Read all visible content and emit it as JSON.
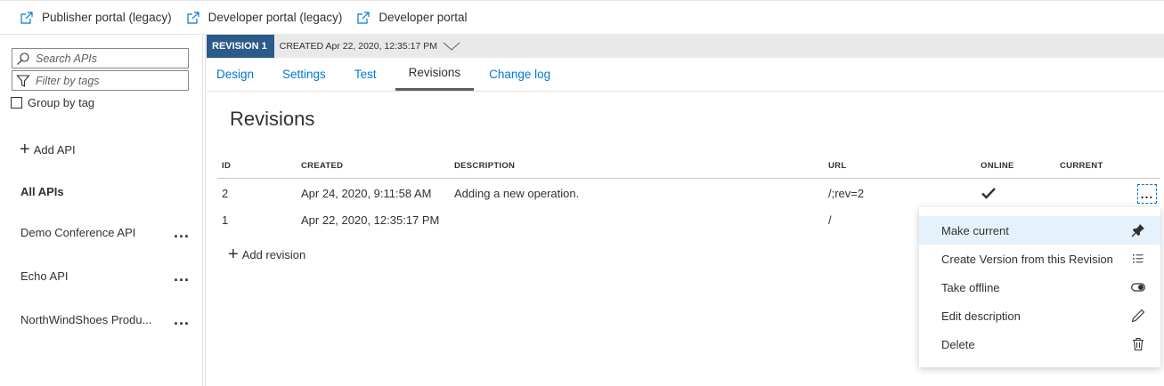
{
  "top_links": [
    {
      "label": "Publisher portal (legacy)",
      "icon": "external-link-icon"
    },
    {
      "label": "Developer portal (legacy)",
      "icon": "external-link-icon"
    },
    {
      "label": "Developer portal",
      "icon": "external-link-icon"
    }
  ],
  "sidebar": {
    "search_placeholder": "Search APIs",
    "filter_placeholder": "Filter by tags",
    "group_by_tag_label": "Group by tag",
    "add_api_label": "Add API",
    "all_apis_label": "All APIs",
    "apis": [
      {
        "name": "Demo Conference API",
        "more": "..."
      },
      {
        "name": "Echo API",
        "more": "..."
      },
      {
        "name": "NorthWindShoes Produ...",
        "more": "..."
      }
    ]
  },
  "revision_bar": {
    "tag": "REVISION 1",
    "created": "CREATED Apr 22, 2020, 12:35:17 PM"
  },
  "tabs": [
    "Design",
    "Settings",
    "Test",
    "Revisions",
    "Change log"
  ],
  "active_tab": "Revisions",
  "main": {
    "title": "Revisions",
    "columns": [
      "ID",
      "CREATED",
      "DESCRIPTION",
      "URL",
      "ONLINE",
      "CURRENT"
    ],
    "rows": [
      {
        "id": "2",
        "created": "Apr 24, 2020, 9:11:58 AM",
        "description": "Adding a new operation.",
        "url": "/;rev=2",
        "online": true,
        "more": "..."
      },
      {
        "id": "1",
        "created": "Apr 22, 2020, 12:35:17 PM",
        "description": "",
        "url": "/",
        "online": false
      }
    ],
    "add_revision_label": "Add revision"
  },
  "context_menu": {
    "items": [
      {
        "label": "Make current",
        "icon": "pin-icon"
      },
      {
        "label": "Create Version from this Revision",
        "icon": "list-icon"
      },
      {
        "label": "Take offline",
        "icon": "toggle-icon"
      },
      {
        "label": "Edit description",
        "icon": "pencil-icon"
      },
      {
        "label": "Delete",
        "icon": "trash-icon"
      }
    ]
  },
  "colors": {
    "link_blue": "#0078d4",
    "revision_tag_bg": "#2c5a8a",
    "menu_hover": "#e6f2fb"
  }
}
